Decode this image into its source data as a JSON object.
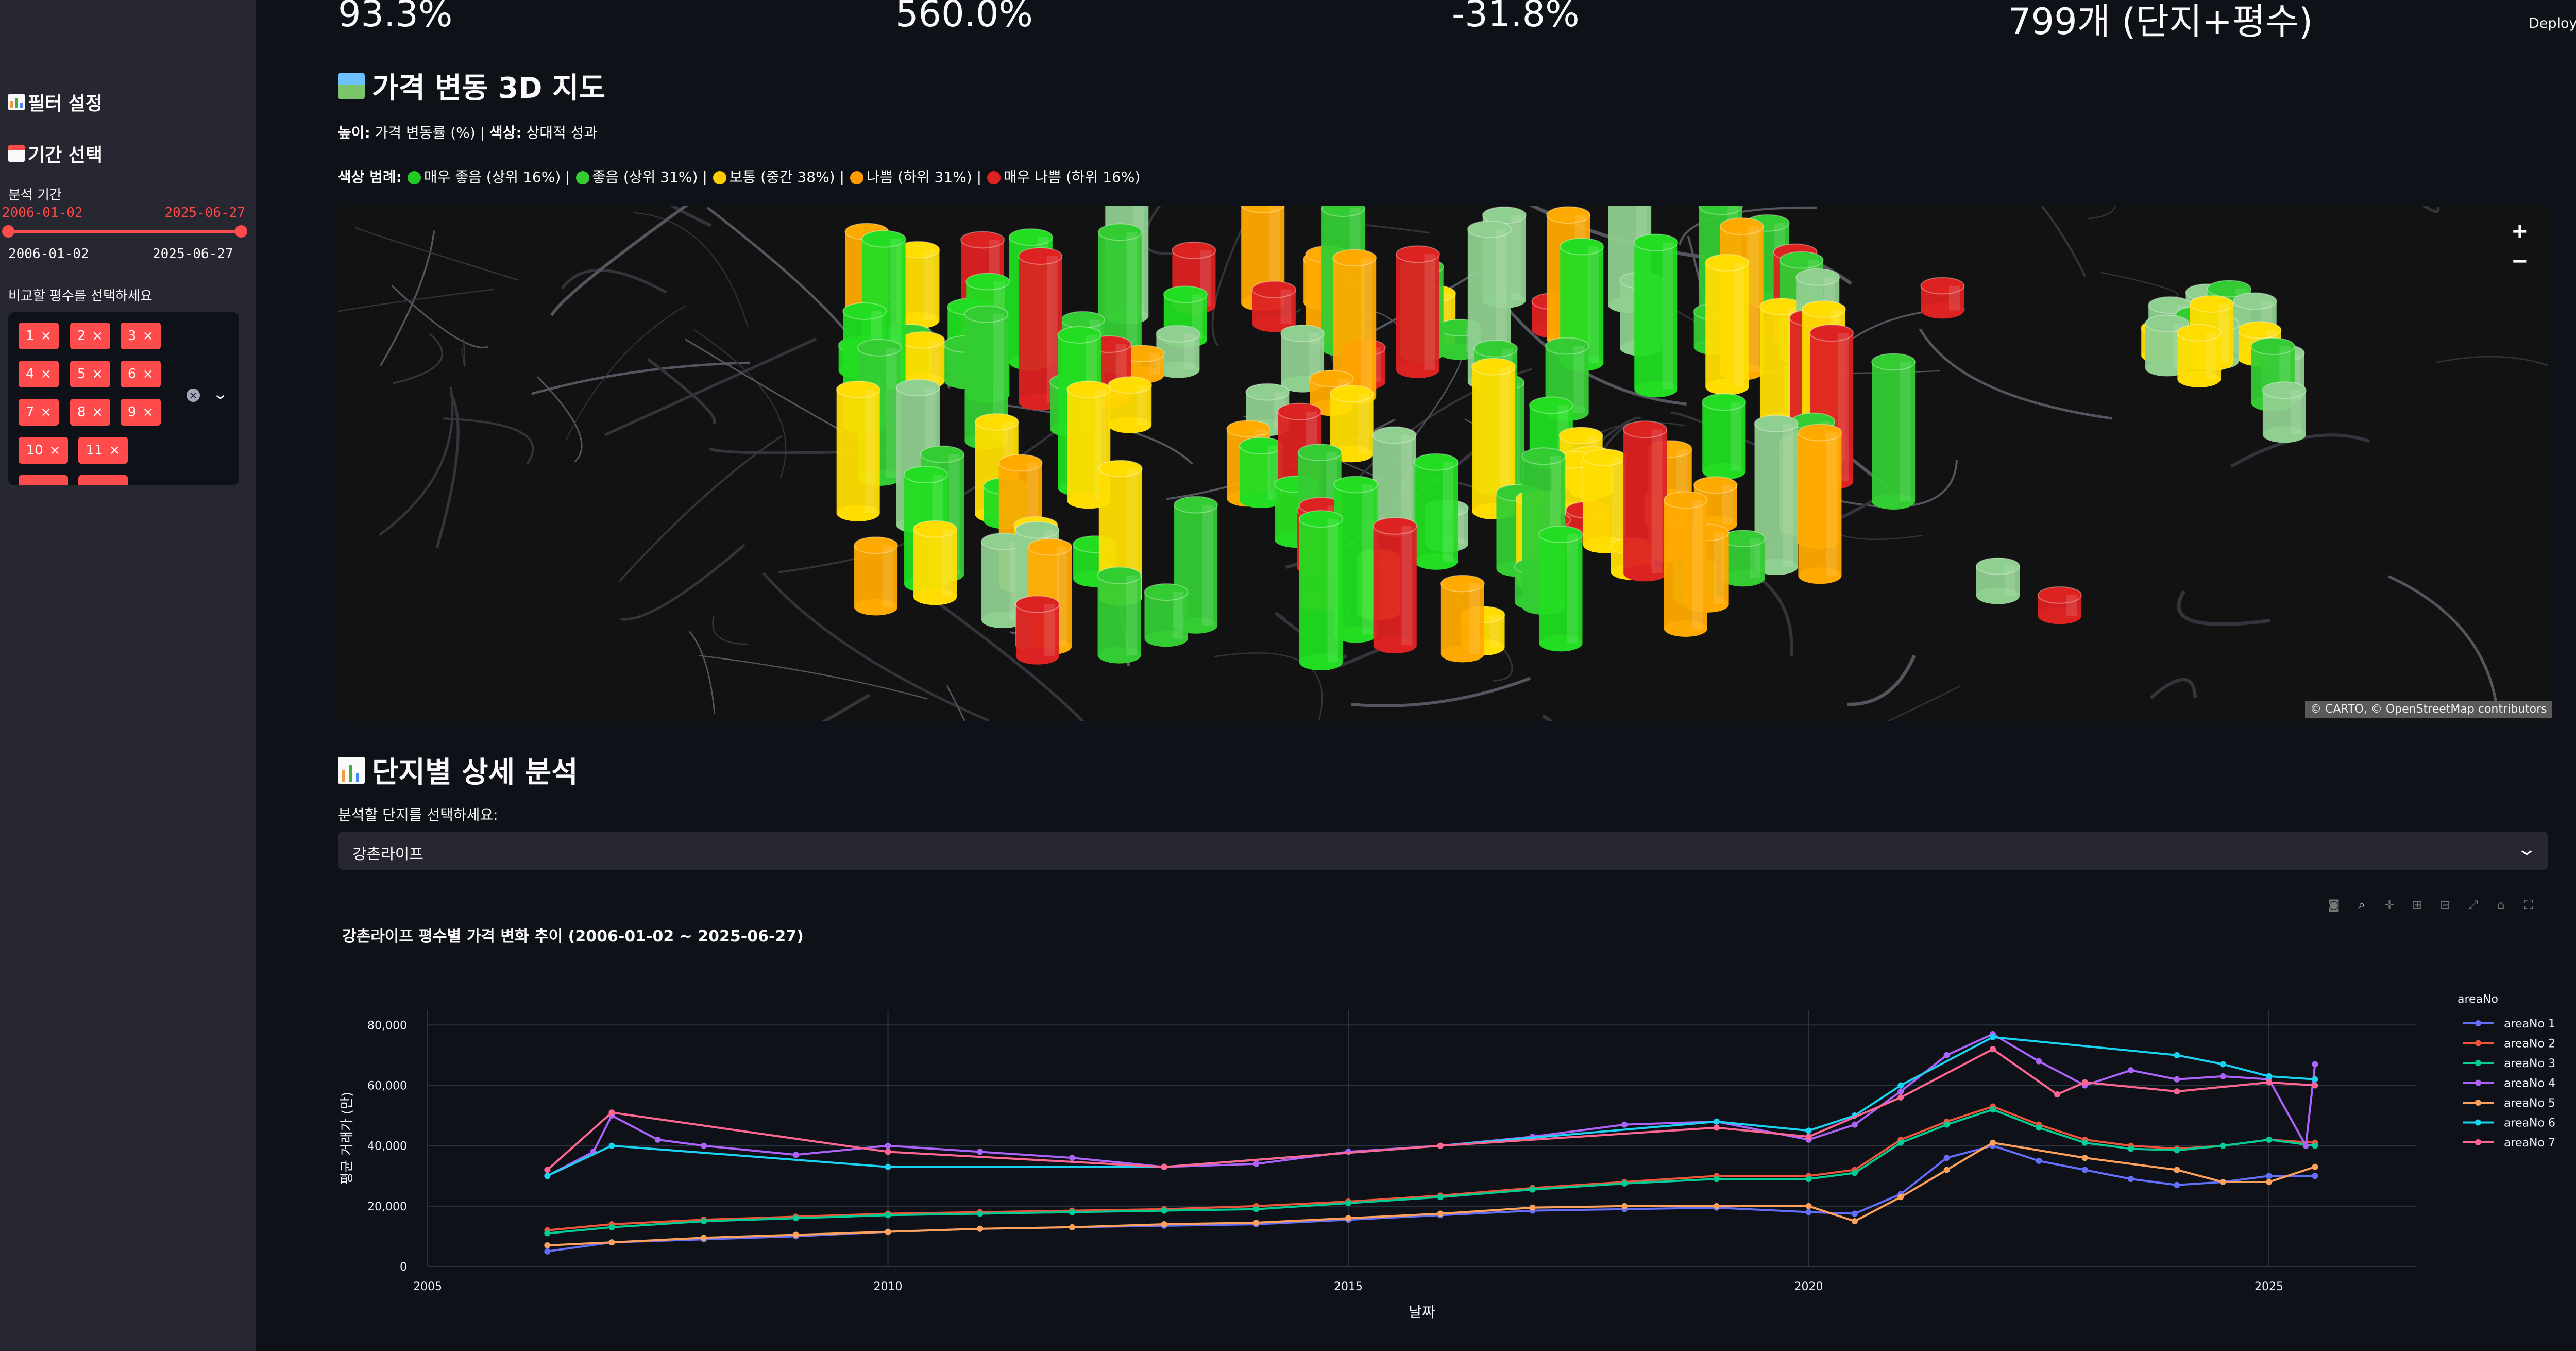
{
  "sidebar": {
    "filter_title": "필터 설정",
    "period_title": "기간 선택",
    "period_label": "분석 기간",
    "slider_start": "2006-01-02",
    "slider_end": "2025-06-27",
    "slider_min": "2006-01-02",
    "slider_max": "2025-06-27",
    "area_label": "비교할 평수를 선택하세요",
    "chips": [
      "1",
      "2",
      "3",
      "4",
      "5",
      "6",
      "7",
      "8",
      "9",
      "10",
      "11"
    ],
    "chip_close": "×",
    "accent": "#ff4b4b"
  },
  "metrics": [
    "93.3%",
    "560.0%",
    "-31.8%",
    "799개 (단지+평수)"
  ],
  "header": {
    "deploy": "Deploy",
    "menu_icon": "⋮"
  },
  "map_section": {
    "title": "가격 변동 3D 지도",
    "desc_b1": "높이:",
    "desc_t1": " 가격 변동률 (%) | ",
    "desc_b2": "색상:",
    "desc_t2": " 상대적 성과",
    "legend_b": "색상 범례:",
    "legend": [
      {
        "color": "#22cc22",
        "text": "매우 좋음 (상위 16%)"
      },
      {
        "color": "#33cc33",
        "text": "좋음 (상위 31%)"
      },
      {
        "color": "#ffcc00",
        "text": "보통 (중간 38%)"
      },
      {
        "color": "#ff9900",
        "text": "나쁨 (하위 31%)"
      },
      {
        "color": "#dd2222",
        "text": "매우 나쁨 (하위 16%)"
      }
    ],
    "zoom_in": "+",
    "zoom_out": "−",
    "attribution": "© CARTO, © OpenStreetMap contributors"
  },
  "detail_section": {
    "title": "단지별 상세 분석",
    "select_label": "분석할 단지를 선택하세요:",
    "selected": "강촌라이프",
    "chart_title": "강촌라이프 평수별 가격 변화 추이 (2006-01-02 ~ 2025-06-27)"
  },
  "chart_data": {
    "type": "line",
    "title": "강촌라이프 평수별 가격 변화 추이 (2006-01-02 ~ 2025-06-27)",
    "xlabel": "날짜",
    "ylabel": "평균 거래가 (만)",
    "xlim": [
      2005,
      2026.6
    ],
    "ylim": [
      0,
      85000
    ],
    "x_ticks": [
      2005,
      2010,
      2015,
      2020,
      2025
    ],
    "y_ticks": [
      0,
      20000,
      40000,
      60000,
      80000
    ],
    "x_tick_labels": [
      "2005",
      "2010",
      "2015",
      "2020",
      "2025"
    ],
    "y_tick_labels": [
      "0",
      "20,000",
      "40,000",
      "60,000",
      "80,000"
    ],
    "legend_title": "areaNo",
    "legend_position": "right",
    "grid": true,
    "series": [
      {
        "name": "areaNo 1",
        "color": "#636efa",
        "x": [
          2006.3,
          2007.0,
          2008.0,
          2009.0,
          2010.0,
          2011.0,
          2012.0,
          2013.0,
          2014.0,
          2015.0,
          2016.0,
          2017.0,
          2018.0,
          2019.0,
          2020.0,
          2020.5,
          2021.0,
          2021.5,
          2022.0,
          2022.5,
          2023.0,
          2023.5,
          2024.0,
          2024.5,
          2025.0,
          2025.5
        ],
        "y": [
          5000,
          8000,
          9000,
          10000,
          11500,
          12500,
          13000,
          13500,
          14000,
          15500,
          17000,
          18500,
          19000,
          19500,
          18000,
          17500,
          24000,
          36000,
          40000,
          35000,
          32000,
          29000,
          27000,
          28000,
          30000,
          30000
        ]
      },
      {
        "name": "areaNo 2",
        "color": "#ef553b",
        "x": [
          2006.3,
          2007.0,
          2008.0,
          2009.0,
          2010.0,
          2011.0,
          2012.0,
          2013.0,
          2014.0,
          2015.0,
          2016.0,
          2017.0,
          2018.0,
          2019.0,
          2020.0,
          2020.5,
          2021.0,
          2021.5,
          2022.0,
          2022.5,
          2023.0,
          2023.5,
          2024.0,
          2024.5,
          2025.0,
          2025.5
        ],
        "y": [
          12000,
          14000,
          15500,
          16500,
          17500,
          18000,
          18500,
          19000,
          20000,
          21500,
          23500,
          26000,
          28000,
          30000,
          30000,
          32000,
          42000,
          48000,
          53000,
          47000,
          42000,
          40000,
          39000,
          40000,
          42000,
          41000
        ]
      },
      {
        "name": "areaNo 3",
        "color": "#00cc96",
        "x": [
          2006.3,
          2007.0,
          2008.0,
          2009.0,
          2010.0,
          2011.0,
          2012.0,
          2013.0,
          2014.0,
          2015.0,
          2016.0,
          2017.0,
          2018.0,
          2019.0,
          2020.0,
          2020.5,
          2021.0,
          2021.5,
          2022.0,
          2022.5,
          2023.0,
          2023.5,
          2024.0,
          2024.5,
          2025.0,
          2025.5
        ],
        "y": [
          11000,
          13000,
          15000,
          16000,
          17000,
          17500,
          18000,
          18500,
          19000,
          21000,
          23000,
          25500,
          27500,
          29000,
          29000,
          31000,
          41000,
          47000,
          52000,
          46000,
          41000,
          39000,
          38500,
          40000,
          42000,
          40000
        ]
      },
      {
        "name": "areaNo 4",
        "color": "#ab63fa",
        "x": [
          2006.3,
          2006.8,
          2007.0,
          2007.5,
          2008.0,
          2009.0,
          2010.0,
          2011.0,
          2012.0,
          2013.0,
          2014.0,
          2015.0,
          2016.0,
          2017.0,
          2018.0,
          2019.0,
          2020.0,
          2020.5,
          2021.0,
          2021.5,
          2022.0,
          2022.5,
          2023.0,
          2023.5,
          2024.0,
          2024.5,
          2025.0,
          2025.4,
          2025.5
        ],
        "y": [
          30000,
          38000,
          50000,
          42000,
          40000,
          37000,
          40000,
          38000,
          36000,
          33000,
          34000,
          38000,
          40000,
          43000,
          47000,
          48000,
          42000,
          47000,
          58000,
          70000,
          77000,
          68000,
          60000,
          65000,
          62000,
          63000,
          62000,
          40000,
          67000
        ]
      },
      {
        "name": "areaNo 5",
        "color": "#ffa15a",
        "x": [
          2006.3,
          2007.0,
          2008.0,
          2009.0,
          2010.0,
          2011.0,
          2012.0,
          2013.0,
          2014.0,
          2015.0,
          2016.0,
          2017.0,
          2018.0,
          2019.0,
          2020.0,
          2020.5,
          2021.0,
          2021.5,
          2022.0,
          2023.0,
          2024.0,
          2024.5,
          2025.0,
          2025.5
        ],
        "y": [
          7000,
          8000,
          9500,
          10500,
          11500,
          12500,
          13000,
          14000,
          14500,
          16000,
          17500,
          19500,
          20000,
          20000,
          20000,
          15000,
          23000,
          32000,
          41000,
          36000,
          32000,
          28000,
          28000,
          33000
        ]
      },
      {
        "name": "areaNo 6",
        "color": "#19d3f3",
        "x": [
          2006.3,
          2007.0,
          2010.0,
          2013.0,
          2016.0,
          2019.0,
          2020.0,
          2020.5,
          2021.0,
          2022.0,
          2024.0,
          2024.5,
          2025.0,
          2025.5
        ],
        "y": [
          30000,
          40000,
          33000,
          33000,
          40000,
          48000,
          45000,
          50000,
          60000,
          76000,
          70000,
          67000,
          63000,
          62000
        ]
      },
      {
        "name": "areaNo 7",
        "color": "#ff6692",
        "x": [
          2006.3,
          2007.0,
          2010.0,
          2013.0,
          2016.0,
          2019.0,
          2020.0,
          2021.0,
          2022.0,
          2022.7,
          2023.0,
          2024.0,
          2025.0,
          2025.5
        ],
        "y": [
          32000,
          51000,
          38000,
          33000,
          40000,
          46000,
          43000,
          56000,
          72000,
          57000,
          61000,
          58000,
          61000,
          60000
        ]
      }
    ]
  }
}
